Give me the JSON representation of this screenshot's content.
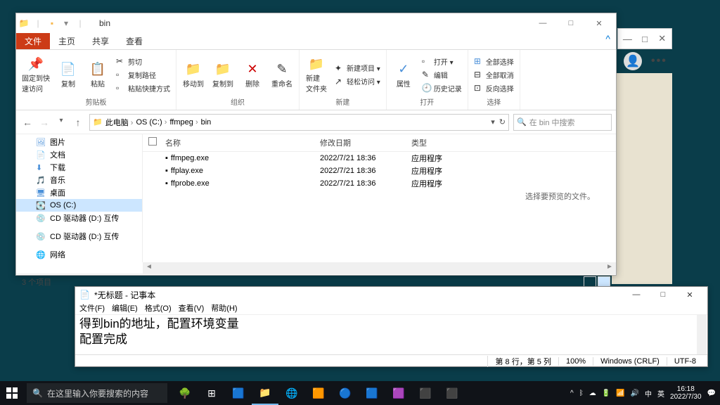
{
  "explorer": {
    "title": "bin",
    "tabs": {
      "file": "文件",
      "home": "主页",
      "share": "共享",
      "view": "查看"
    },
    "ribbon": {
      "pin": "固定到快\n速访问",
      "copy": "复制",
      "paste": "粘贴",
      "cut": "剪切",
      "copypath": "复制路径",
      "pasteshortcut": "粘贴快捷方式",
      "moveto": "移动到",
      "copyto": "复制到",
      "delete": "删除",
      "rename": "重命名",
      "newfolder": "新建\n文件夹",
      "newitem": "新建项目 ▾",
      "easyaccess": "轻松访问 ▾",
      "properties": "属性",
      "open": "打开 ▾",
      "edit": "编辑",
      "history": "历史记录",
      "selectall": "全部选择",
      "selectnone": "全部取消",
      "invertsel": "反向选择",
      "g_clipboard": "剪贴板",
      "g_organize": "组织",
      "g_new": "新建",
      "g_open": "打开",
      "g_select": "选择"
    },
    "breadcrumbs": [
      "此电脑",
      "OS (C:)",
      "ffmpeg",
      "bin"
    ],
    "search_placeholder": "在 bin 中搜索",
    "sidebar": {
      "pictures": "图片",
      "documents": "文档",
      "downloads": "下载",
      "music": "音乐",
      "desktop": "桌面",
      "osc": "OS (C:)",
      "cddrive": "CD 驱动器 (D:) 互传",
      "cddrive2": "CD 驱动器 (D:) 互传",
      "network": "网络"
    },
    "columns": {
      "name": "名称",
      "date": "修改日期",
      "type": "类型"
    },
    "files": [
      {
        "name": "ffmpeg.exe",
        "date": "2022/7/21 18:36",
        "type": "应用程序"
      },
      {
        "name": "ffplay.exe",
        "date": "2022/7/21 18:36",
        "type": "应用程序"
      },
      {
        "name": "ffprobe.exe",
        "date": "2022/7/21 18:36",
        "type": "应用程序"
      }
    ],
    "hint": "选择要预览的文件。",
    "status": "3 个项目"
  },
  "notepad": {
    "title": "*无标题 - 记事本",
    "menu": {
      "file": "文件(F)",
      "edit": "编辑(E)",
      "format": "格式(O)",
      "view": "查看(V)",
      "help": "帮助(H)"
    },
    "line1": "得到bin的地址，配置环境变量",
    "line2": "配置完成",
    "status": {
      "pos": "第 8 行，第 5 列",
      "zoom": "100%",
      "eol": "Windows (CRLF)",
      "enc": "UTF-8"
    }
  },
  "taskbar": {
    "search_placeholder": "在这里输入你要搜索的内容",
    "time": "16:18",
    "date": "2022/7/30",
    "ime1": "中",
    "ime2": "英"
  }
}
